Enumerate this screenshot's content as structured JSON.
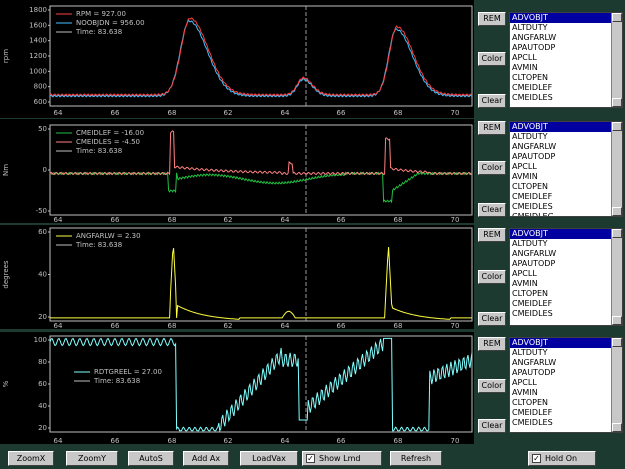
{
  "colors": {
    "rpm": "#ff4040",
    "nooe": "#40c0ff",
    "time": "#c0c0c0",
    "green": "#20c040",
    "pink": "#ff8080",
    "yellow": "#ffff40",
    "cyan": "#80ffff",
    "axis": "#c0c0c0"
  },
  "x_ticks": [
    "64",
    "66",
    "68",
    "62",
    "64",
    "66",
    "68",
    "70"
  ],
  "x_ticks_p1": [
    "64",
    "66",
    "68",
    "62",
    "64",
    "66",
    "68",
    "70"
  ],
  "cursor_time": 83.6,
  "panels": [
    {
      "ylabel": "rpm",
      "y_ticks": [
        "1800",
        "1600",
        "1400",
        "1200",
        "1000",
        "800",
        "600"
      ],
      "legend": [
        {
          "text": "RPM = 927.00",
          "color": "#ff4040"
        },
        {
          "text": "NOOBJDN = 956.00",
          "color": "#40c0ff"
        },
        {
          "text": "Time: 83.638",
          "color": "#c0c0c0"
        }
      ],
      "list": [
        "ADVOBJT",
        "ALTDUTY",
        "ANGFARLW",
        "APAUTODP",
        "APCLL",
        "AVMIN",
        "CLTOPEN",
        "CMEIDLEF",
        "CMEIDLES"
      ]
    },
    {
      "ylabel": "Nm",
      "y_ticks": [
        "50",
        "0",
        "-50"
      ],
      "legend": [
        {
          "text": "CMEIDLEF = -16.00",
          "color": "#20c040"
        },
        {
          "text": "CMEIDLES = -4.50",
          "color": "#ff8080"
        },
        {
          "text": "Time: 83.638",
          "color": "#c0c0c0"
        }
      ],
      "list": [
        "ADVOBJT",
        "ALTDUTY",
        "ANGFARLW",
        "APAUTODP",
        "APCLL",
        "AVMIN",
        "CLTOPEN",
        "CMEIDLEF",
        "CMEIDLES",
        "CMEIDLEG"
      ]
    },
    {
      "ylabel": "degrees",
      "y_ticks": [
        "60",
        "40",
        "20"
      ],
      "legend": [
        {
          "text": "ANGFARLW = 2.30",
          "color": "#ffff40"
        },
        {
          "text": "Time: 83.638",
          "color": "#c0c0c0"
        }
      ],
      "list": [
        "ADVOBJT",
        "ALTDUTY",
        "ANGFARLW",
        "APAUTODP",
        "APCLL",
        "AVMIN",
        "CLTOPEN",
        "CMEIDLEF",
        "CMEIDLES"
      ]
    },
    {
      "ylabel": "%",
      "y_ticks": [
        "100",
        "80",
        "60",
        "40",
        "20"
      ],
      "legend": [
        {
          "text": "RDTGREEL = 27.00",
          "color": "#80ffff"
        },
        {
          "text": "Time: 83.638",
          "color": "#c0c0c0"
        }
      ],
      "list": [
        "ADVOBJT",
        "ALTDUTY",
        "ANGFARLW",
        "APAUTODP",
        "APCLL",
        "AVMIN",
        "CLTOPEN",
        "CMEIDLEF",
        "CMEIDLES"
      ]
    }
  ],
  "side_buttons": {
    "rem": "REM",
    "color": "Color",
    "clear": "Clear"
  },
  "toolbar": {
    "zoomx": "ZoomX",
    "zoomy": "ZoomY",
    "autos": "AutoS",
    "addax": "Add Ax",
    "loadvax": "LoadVax",
    "showlmd": "Show Lmd",
    "refresh": "Refresh",
    "holdon": "Hold On",
    "showlmd_checked": true,
    "holdon_checked": true
  }
}
